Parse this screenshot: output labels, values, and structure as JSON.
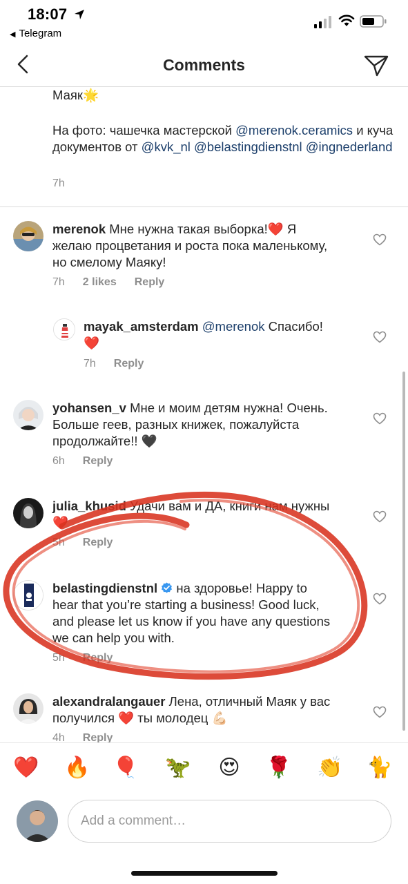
{
  "status": {
    "time": "18:07",
    "back_app": "Telegram"
  },
  "nav": {
    "title": "Comments"
  },
  "caption": {
    "line1": "Маяк",
    "line1_emoji": "🌟",
    "text_prefix": "На фото: чашечка мастерской ",
    "mention1": "@merenok.ceramics",
    "text_mid": " и куча документов от ",
    "mention2": "@kvk_nl",
    "mention3": "@belastingdienstnl",
    "mention4": "@ingnederland",
    "time": "7h"
  },
  "comments": [
    {
      "user": "merenok",
      "text": "Мне нужна такая выборка!❤️ Я желаю процветания и роста пока маленькому, но смелому Маяку!",
      "time": "7h",
      "likes": "2 likes",
      "reply": "Reply"
    },
    {
      "user": "mayak_amsterdam",
      "mention": "@merenok",
      "text": " Спасибо!",
      "text2": "❤️",
      "time": "7h",
      "reply": "Reply"
    },
    {
      "user": "yohansen_v",
      "text": "Мне и моим детям нужна! Очень. Больше геев, разных книжек, пожалуйста продолжайте!! 🖤",
      "time": "6h",
      "reply": "Reply"
    },
    {
      "user": "julia_khusid",
      "text": "Удачи вам и ДА, книги нам нужны ❤️",
      "time": "5h",
      "reply": "Reply"
    },
    {
      "user": "belastingdienstnl",
      "text": "на здоровье! Happy to hear that you’re starting a business! Good luck, and please let us know if you have any questions we can help you with.",
      "time": "5h",
      "reply": "Reply"
    },
    {
      "user": "alexandralangauer",
      "text": "Лена, отличный Маяк у вас получился ❤️ ты молодец 💪🏻",
      "time": "4h",
      "reply": "Reply"
    }
  ],
  "emoji_bar": [
    "❤️",
    "🔥",
    "🎈",
    "🦖",
    "😍",
    "🌹",
    "👏",
    "🐈"
  ],
  "input": {
    "placeholder": "Add a comment…"
  },
  "colors": {
    "mention": "#1c3f6b",
    "meta": "#8e8e8e",
    "annotation": "#d8321f",
    "verified": "#3897f0"
  }
}
